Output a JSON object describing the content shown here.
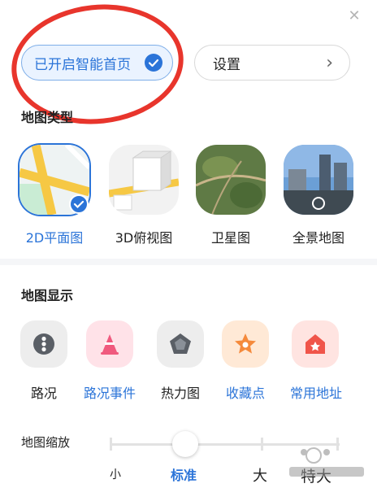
{
  "header": {
    "close_icon": "close-icon"
  },
  "smart_home": {
    "label": "已开启智能首页",
    "checked": true,
    "accent": "#2b74d8"
  },
  "settings": {
    "label": "设置"
  },
  "map_type": {
    "title": "地图类型",
    "options": [
      {
        "label": "2D平面图",
        "selected": true
      },
      {
        "label": "3D俯视图",
        "selected": false
      },
      {
        "label": "卫星图",
        "selected": false
      },
      {
        "label": "全景地图",
        "selected": false
      }
    ]
  },
  "map_display": {
    "title": "地图显示",
    "items": [
      {
        "label": "路况",
        "icon": "traffic-light-icon",
        "active": false
      },
      {
        "label": "路况事件",
        "icon": "traffic-cone-icon",
        "active": true
      },
      {
        "label": "热力图",
        "icon": "pentagon-icon",
        "active": false
      },
      {
        "label": "收藏点",
        "icon": "star-icon",
        "active": true
      },
      {
        "label": "常用地址",
        "icon": "home-icon",
        "active": true
      }
    ]
  },
  "map_zoom": {
    "title": "地图缩放",
    "options": [
      "小",
      "标准",
      "大",
      "特大"
    ],
    "selected": "标准"
  },
  "annotation": {
    "color": "#e8352c"
  }
}
